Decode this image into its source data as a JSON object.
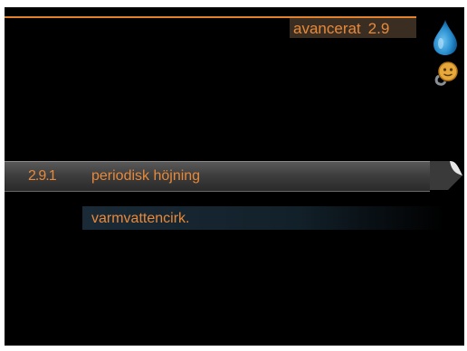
{
  "header": {
    "title": "avancerat",
    "menu_number": "2.9"
  },
  "side_icons": [
    "water-drop-icon",
    "gear-face-icon"
  ],
  "menu": {
    "items": [
      {
        "number": "2.9.1",
        "label": "periodisk höjning",
        "selected": true
      },
      {
        "number": "",
        "label": "varmvattencirk.",
        "selected": false
      }
    ]
  },
  "colors": {
    "accent": "#e8893a",
    "header_bg": "#3a2e22",
    "background": "#000000"
  }
}
